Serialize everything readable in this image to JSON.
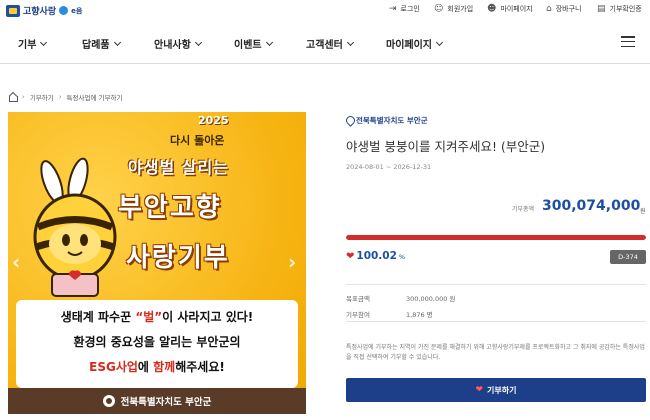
{
  "header": {
    "logo_text": "고향사랑",
    "logo_badge": "e음",
    "util_links": [
      {
        "label": "로그인",
        "icon": "login-icon"
      },
      {
        "label": "회원가입",
        "icon": "user-icon"
      },
      {
        "label": "마이페이지",
        "icon": "person-icon"
      },
      {
        "label": "장바구니",
        "icon": "cart-icon"
      },
      {
        "label": "기부확인증",
        "icon": "document-icon"
      }
    ]
  },
  "nav": {
    "items": [
      "기부",
      "답례품",
      "안내사항",
      "이벤트",
      "고객센터",
      "마이페이지"
    ]
  },
  "breadcrumb": {
    "items": [
      "기부하기",
      "특정사업에 기부하기"
    ]
  },
  "poster": {
    "year": "2025",
    "subtitle": "다시 돌아온",
    "title1": "야생벌 살리는",
    "title2": "부안고향",
    "title3": "사랑기부",
    "line1_pre": "생태계 파수꾼 ",
    "line1_hl": "“벌”",
    "line1_post": "이 사라지고 있다!",
    "line2": "환경의 중요성을 알리는 부안군의",
    "line3_hl1": "ESG사업",
    "line3_mid": "에 ",
    "line3_hl2": "함께",
    "line3_post": "해주세요!",
    "footer": "전북특별자치도 부안군"
  },
  "project": {
    "region": "전북특별자치도 부안군",
    "title": "야생벌 붕붕이를 지켜주세요! (부안군)",
    "date_range": "2024-08-01 ~ 2026-12-31",
    "amount_label": "기부총액",
    "amount": "300,074,000",
    "amount_unit": "원",
    "progress_fraction": 1.0,
    "percent": "100.02",
    "percent_unit": "%",
    "dday": "D-374",
    "goal_label": "목표금액",
    "goal_value": "300,000,000 원",
    "participants_label": "기부참여",
    "participants_value": "1,876 명",
    "note": "특정사업에 기부하는 지역이 가진 문제를 해결하기 위해 고향사랑기부제를 프로젝트화하고 그 취지에 공감하는 특정사업을 직접 선택하여 기부할 수 있습니다.",
    "donate_label": "기부하기"
  },
  "colors": {
    "brand_blue": "#1d3f8a",
    "accent_red": "#d62b2b",
    "poster_yellow": "#f6b311"
  }
}
